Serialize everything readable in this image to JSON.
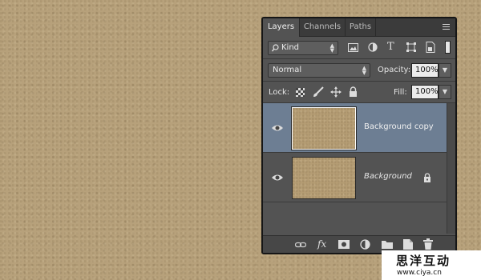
{
  "tabs": [
    {
      "label": "Layers",
      "active": true
    },
    {
      "label": "Channels",
      "active": false
    },
    {
      "label": "Paths",
      "active": false
    }
  ],
  "filter": {
    "kind_label": "Kind"
  },
  "blend": {
    "mode": "Normal",
    "opacity_label": "Opacity:",
    "opacity_value": "100%"
  },
  "lock": {
    "label": "Lock:",
    "fill_label": "Fill:",
    "fill_value": "100%"
  },
  "layers": [
    {
      "name": "Background copy",
      "selected": true,
      "visible": true
    },
    {
      "name": "Background",
      "selected": false,
      "visible": true,
      "locked": true
    }
  ],
  "bottom_bar": {
    "fx_label": "fx"
  },
  "watermark": {
    "title": "思洋互动",
    "url": "www.ciya.cn"
  },
  "colors": {
    "panel": "#535353",
    "selected_layer": "#6d7e93",
    "canvas": "#b7a17b"
  }
}
